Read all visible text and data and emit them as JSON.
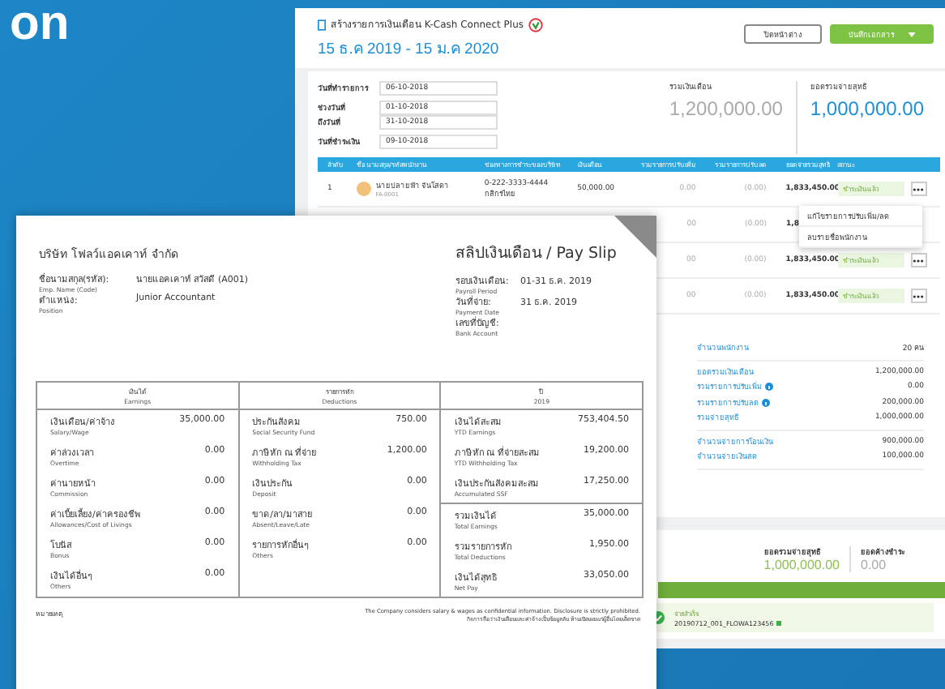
{
  "hero_text": "on",
  "app": {
    "title": "สร้างรายการเงินเดือน K-Cash Connect Plus",
    "date_range": "15 ธ.ค 2019 - 15 ม.ค 2020",
    "buttons": [
      {
        "label": "ปิดหน้าต่าง",
        "kind": "outline"
      },
      {
        "label": "บันทึกเอกสาร",
        "kind": "primary"
      }
    ],
    "field_groups": [
      [
        {
          "label": "วันที่ทำรายการ",
          "value": "06-10-2018"
        }
      ],
      [
        {
          "label": "ช่วงวันที่",
          "value": "01-10-2018"
        },
        {
          "label": "ถึงวันที่",
          "value": "31-10-2018"
        }
      ],
      [
        {
          "label": "วันที่ชำระเงิน",
          "value": "09-10-2018"
        }
      ]
    ],
    "totals": [
      {
        "label": "รวมเงินเดือน",
        "value": "1,200,000.00",
        "kind": "muted"
      },
      {
        "label": "ยอดรวมจ่ายสุทธิ",
        "value": "1,000,000.00",
        "kind": "accent"
      }
    ],
    "table": {
      "columns": [
        "ลำดับ",
        "ชื่อ นามสกุล/รหัสพนักงาน",
        "ช่องทางการชำระของบริษัท",
        "เงินเดือน",
        "รวมรายการปรับเพิ่ม",
        "รวมรายการปรับลด",
        "ยอดจ่ายรวมสุทธิ",
        "สถานะ"
      ],
      "rows": [
        {
          "index": "1",
          "name": "นายปลายฟ้า จันโสดา",
          "code": "FA-0001",
          "account": "0-222-3333-4444",
          "bank": "กสิกรไทย",
          "salary": "50,000.00",
          "adjust_up": "0.00",
          "adjust_down": "(0.00)",
          "net": "1,833,450.00",
          "status": "ชำระเงินแล้ว"
        },
        {
          "adjust_up": "00",
          "adjust_down": "(0.00)",
          "net": "1,8"
        },
        {
          "adjust_up": "00",
          "adjust_down": "(0.00)",
          "net": "1,833,450.00",
          "status": "ชำระเงินแล้ว"
        },
        {
          "adjust_up": "00",
          "adjust_down": "(0.00)",
          "net": "1,833,450.00",
          "status": "ชำระเงินแล้ว"
        }
      ]
    },
    "row_menu": [
      "แก้ไขรายการปรับเพิ่ม/ลด",
      "ลบรายชื่อพนักงาน"
    ],
    "summary": [
      [
        {
          "label": "จำนวนพนักงาน",
          "value": "20 คน",
          "info": false
        }
      ],
      [
        {
          "label": "ยอดรวมเงินเดือน",
          "value": "1,200,000.00",
          "info": false
        },
        {
          "label": "รวมรายการปรับเพิ่ม",
          "value": "0.00",
          "info": true
        },
        {
          "label": "รวมรายการปรับลด",
          "value": "200,000.00",
          "info": true
        },
        {
          "label": "รวมจ่ายสุทธิ",
          "value": "1,000,000.00",
          "info": false
        }
      ],
      [
        {
          "label": "จำนวนจ่ายการโอนเงิน",
          "value": "900,000.00",
          "info": false
        },
        {
          "label": "จำนวนจ่ายเงินสด",
          "value": "100,000.00",
          "info": false
        }
      ]
    ],
    "footer_totals": [
      {
        "label": "ยอดรวมจ่ายสุทธิ",
        "value": "1,000,000.00",
        "kind": "success"
      },
      {
        "label": "ยอดค้างชำระ",
        "value": "0.00",
        "kind": "muted"
      }
    ],
    "success_note": {
      "title": "จ่ายสำเร็จ",
      "reference": "20190712_001_FLOWA123456"
    }
  },
  "payslip": {
    "company": "บริษัท โฟลว์แอคเคาท์ จำกัด",
    "title": "สลิปเงินเดือน / Pay Slip",
    "employee": [
      {
        "label": "ชื่อนามสกุล(รหัส):",
        "sub": "Emp. Name (Code)",
        "value": "นายแอคเคาท์ สวัสดี (A001)"
      },
      {
        "label": "ตำแหน่ง:",
        "sub": "Position",
        "value": "Junior Accountant"
      }
    ],
    "period": [
      {
        "label": "รอบเงินเดือน:",
        "sub": "Payroll Period",
        "value": "01-31 ธ.ค. 2019"
      },
      {
        "label": "วันที่จ่าย:",
        "sub": "Payment Date",
        "value": "31 ธ.ค. 2019"
      },
      {
        "label": "เลขที่บัญชี:",
        "sub": "Bank Account"
      }
    ],
    "columns": [
      {
        "title": "เงินได้",
        "sub": "Earnings",
        "items": [
          {
            "label": "เงินเดือน/ค่าจ้าง",
            "sub": "Salary/Wage",
            "value": "35,000.00",
            "divider": false
          },
          {
            "label": "ค่าล่วงเวลา",
            "sub": "Overtime",
            "value": "0.00",
            "divider": false
          },
          {
            "label": "ค่านายหน้า",
            "sub": "Commission",
            "value": "0.00",
            "divider": false
          },
          {
            "label": "ค่าเบี้ยเลี้ยง/ค่าครองชีพ",
            "sub": "Allowances/Cost of Livings",
            "value": "0.00",
            "divider": false
          },
          {
            "label": "โบนัส",
            "sub": "Bonus",
            "value": "0.00",
            "divider": false
          },
          {
            "label": "เงินได้อื่นๆ",
            "sub": "Others",
            "value": "0.00",
            "divider": false
          }
        ]
      },
      {
        "title": "รายการหัก",
        "sub": "Deductions",
        "items": [
          {
            "label": "ประกันสังคม",
            "sub": "Social Security Fund",
            "value": "750.00",
            "divider": false
          },
          {
            "label": "ภาษีหัก ณ ที่จ่าย",
            "sub": "Withholding Tax",
            "value": "1,200.00",
            "divider": false
          },
          {
            "label": "เงินประกัน",
            "sub": "Deposit",
            "value": "0.00",
            "divider": false
          },
          {
            "label": "ขาด/ลา/มาสาย",
            "sub": "Absent/Leave/Late",
            "value": "0.00",
            "divider": false
          },
          {
            "label": "รายการหักอื่นๆ",
            "sub": "Others",
            "value": "0.00",
            "divider": false
          }
        ]
      },
      {
        "title": "ปี",
        "sub": "2019",
        "items": [
          {
            "label": "เงินได้สะสม",
            "sub": "YTD Earnings",
            "value": "753,404.50",
            "divider": false
          },
          {
            "label": "ภาษีหัก ณ ที่จ่ายสะสม",
            "sub": "YTD Withholding Tax",
            "value": "19,200.00",
            "divider": false
          },
          {
            "label": "เงินประกันสังคมสะสม",
            "sub": "Accumulated SSF",
            "value": "17,250.00",
            "divider": false
          },
          {
            "label": "รวมเงินได้",
            "sub": "Total Earnings",
            "value": "35,000.00",
            "divider": true
          },
          {
            "label": "รวมรายการหัก",
            "sub": "Total Deductions",
            "value": "1,950.00",
            "divider": false
          },
          {
            "label": "เงินได้สุทธิ",
            "sub": "Net Pay",
            "value": "33,050.00",
            "divider": false
          }
        ]
      }
    ],
    "remark": "หมายเหตุ",
    "notice": [
      "The Company considers salary & wages as confidential information. Disclosure is strictly prohibited.",
      "กิจการถือว่าเงินเดือนและค่าจ้างเป็นข้อมูลลับ ห้ามเปิดเผยแก่ผู้อื่นโดยเด็ดขาด"
    ]
  }
}
